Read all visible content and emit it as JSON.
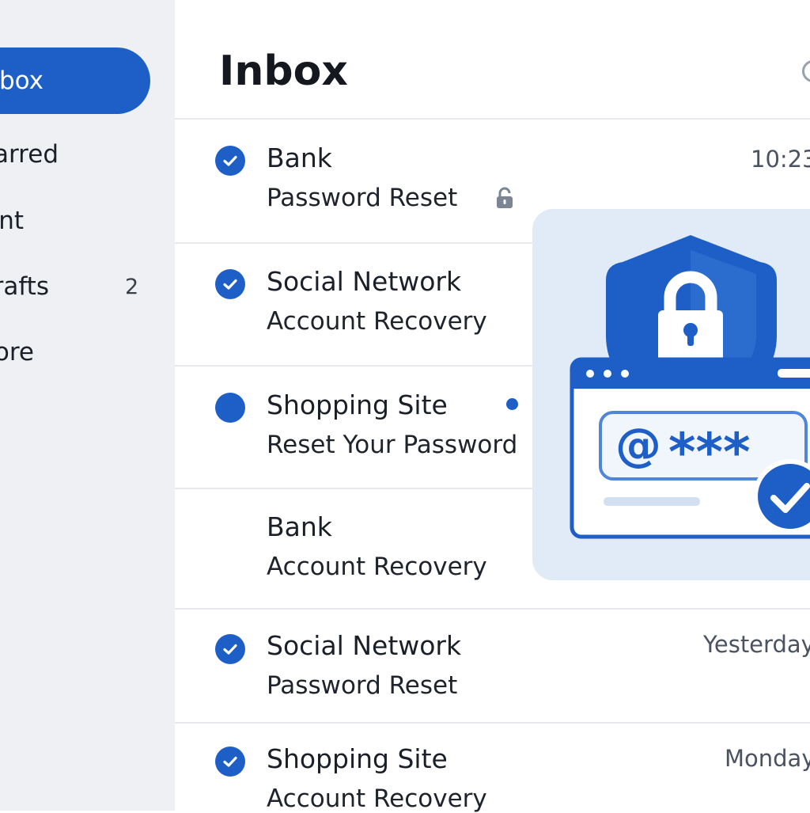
{
  "sidebar": {
    "items": [
      {
        "label": "Inbox",
        "active": true
      },
      {
        "label": "Starred"
      },
      {
        "label": "Sent"
      },
      {
        "label": "Drafts",
        "count": "2"
      },
      {
        "label": "More"
      }
    ]
  },
  "header": {
    "title": "Inbox",
    "search_icon": "search-icon"
  },
  "messages": [
    {
      "sender": "Bank",
      "subject": "Password Reset",
      "time": "10:23",
      "status": "read",
      "icon": "lock-icon"
    },
    {
      "sender": "Social Network",
      "subject": "Account Recovery",
      "status": "read"
    },
    {
      "sender": "Shopping Site",
      "subject": "Reset Your Password",
      "status": "unread"
    },
    {
      "sender": "Bank",
      "subject": "Account Recovery",
      "status": "none"
    },
    {
      "sender": "Social Network",
      "subject": "Password Reset",
      "time": "Yesterday",
      "status": "read"
    },
    {
      "sender": "Shopping Site",
      "subject": "Account Recovery",
      "time": "Monday",
      "status": "read"
    }
  ],
  "illustration": {
    "password_mask": "***",
    "at_symbol": "@",
    "icons": [
      "shield-icon",
      "lock-icon",
      "browser-window-icon",
      "checkmark-icon"
    ]
  },
  "colors": {
    "accent": "#1d5fc7",
    "sidebar_bg": "#eef0f4",
    "illustration_bg": "#e1ebf7"
  }
}
